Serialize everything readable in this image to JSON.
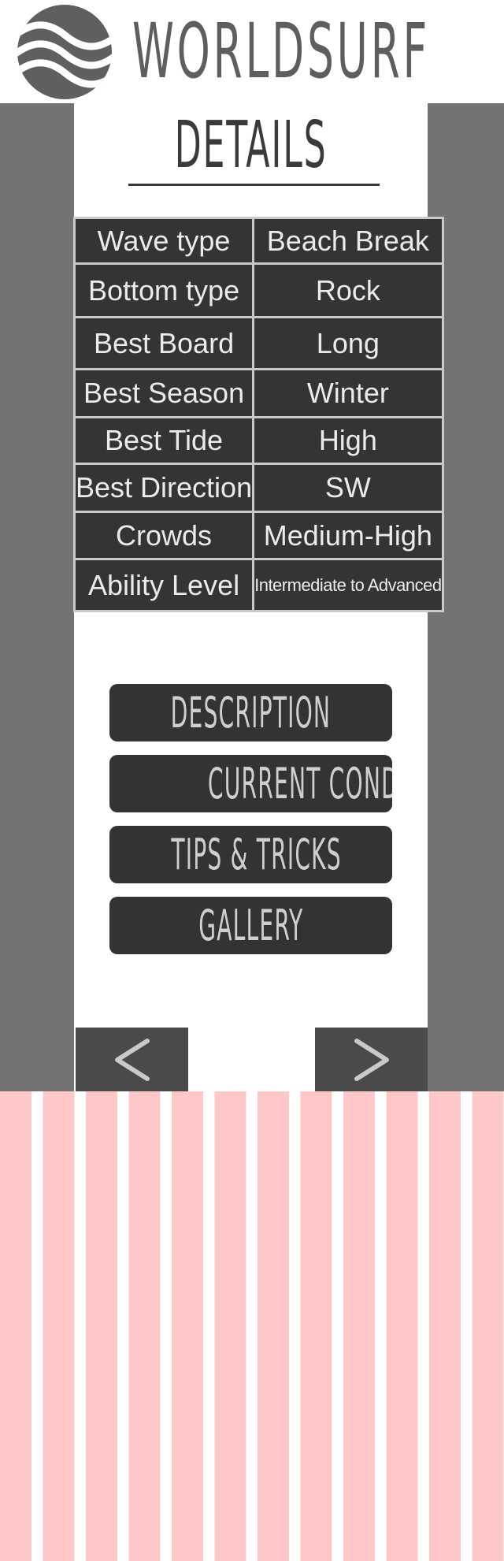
{
  "header": {
    "brand": "WORLDSURF",
    "logo_icon": "wave-icon"
  },
  "page": {
    "title": "DETAILS"
  },
  "details": [
    {
      "label": "Wave type",
      "value": "Beach Break"
    },
    {
      "label": "Bottom type",
      "value": "Rock"
    },
    {
      "label": "Best Board",
      "value": "Long"
    },
    {
      "label": "Best Season",
      "value": "Winter"
    },
    {
      "label": "Best Tide",
      "value": "High"
    },
    {
      "label": "Best Direction",
      "value": "SW"
    },
    {
      "label": "Crowds",
      "value": "Medium-High"
    },
    {
      "label": "Ability Level",
      "value": "Intermediate to Advanced"
    }
  ],
  "menu": {
    "description": "DESCRIPTION",
    "current_conditions": "CURRENT CONDITIONS",
    "tips_tricks": "TIPS & TRICKS",
    "gallery": "GALLERY"
  },
  "navigation": {
    "prev_icon": "chevron-left-icon",
    "next_icon": "chevron-right-icon"
  },
  "colors": {
    "side_gray": "#737373",
    "dark_cell": "#343434",
    "button_dark": "#333333",
    "stripe_pink": "#fec8c9"
  }
}
